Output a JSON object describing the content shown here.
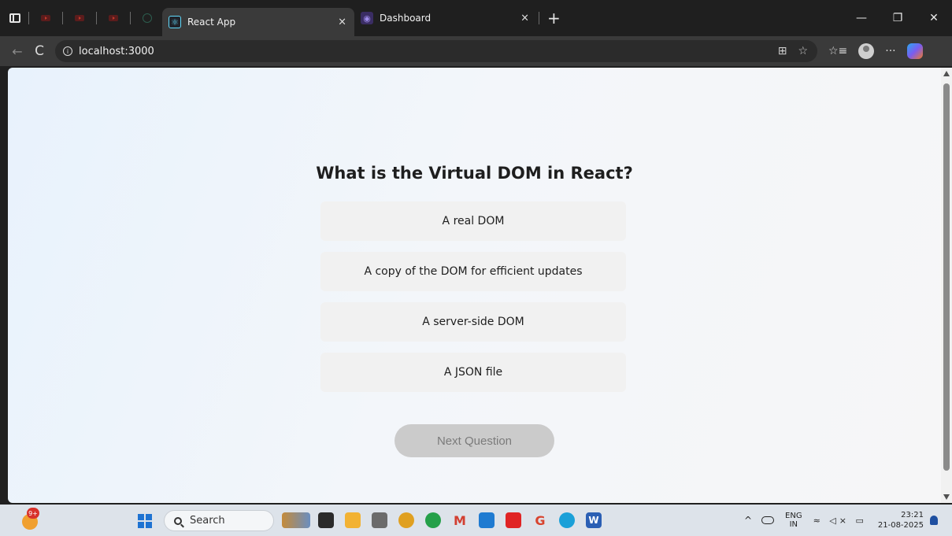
{
  "browser": {
    "tabs": [
      {
        "title": "React App",
        "close": "×",
        "favicon": "react-icon",
        "active": true
      },
      {
        "title": "Dashboard",
        "close": "×",
        "favicon": "dashboard-icon",
        "active": false
      }
    ],
    "new_tab": "+",
    "window_controls": {
      "minimize": "—",
      "restore": "❐",
      "close": "✕"
    },
    "address": {
      "url": "localhost:3000",
      "info": "i"
    },
    "nav": {
      "back": "←",
      "reload": "C"
    },
    "toolbar": {
      "split": "⊞",
      "favorite": "☆",
      "favorites_list": "☆≡",
      "more": "···"
    }
  },
  "quiz": {
    "question": "What is the Virtual DOM in React?",
    "options": [
      "A real DOM",
      "A copy of the DOM for efficient updates",
      "A server-side DOM",
      "A JSON file"
    ],
    "next_label": "Next Question"
  },
  "taskbar": {
    "weather_badge": "9+",
    "search_placeholder": "Search",
    "apps": [
      {
        "name": "file-explorer",
        "label": "",
        "color": "#f2b233"
      },
      {
        "name": "camera",
        "label": "",
        "color": "#6b6b6b"
      },
      {
        "name": "chrome",
        "label": "",
        "color": "#e0a020"
      },
      {
        "name": "whatsapp",
        "label": "",
        "color": "#25a049"
      },
      {
        "name": "gmail",
        "label": "M",
        "color": "#d23f31"
      },
      {
        "name": "vscode",
        "label": "",
        "color": "#1f7bd1"
      },
      {
        "name": "youtube",
        "label": "",
        "color": "#e02424"
      },
      {
        "name": "google",
        "label": "G",
        "color": "#ffffff"
      },
      {
        "name": "edge",
        "label": "",
        "color": "#1aa0d8"
      },
      {
        "name": "word",
        "label": "W",
        "color": "#2b5fb4"
      }
    ],
    "tray": {
      "chevron": "^",
      "lang_top": "ENG",
      "lang_bottom": "IN",
      "sys": "≈ ◁× ▭",
      "time": "23:21",
      "date": "21-08-2025"
    }
  }
}
